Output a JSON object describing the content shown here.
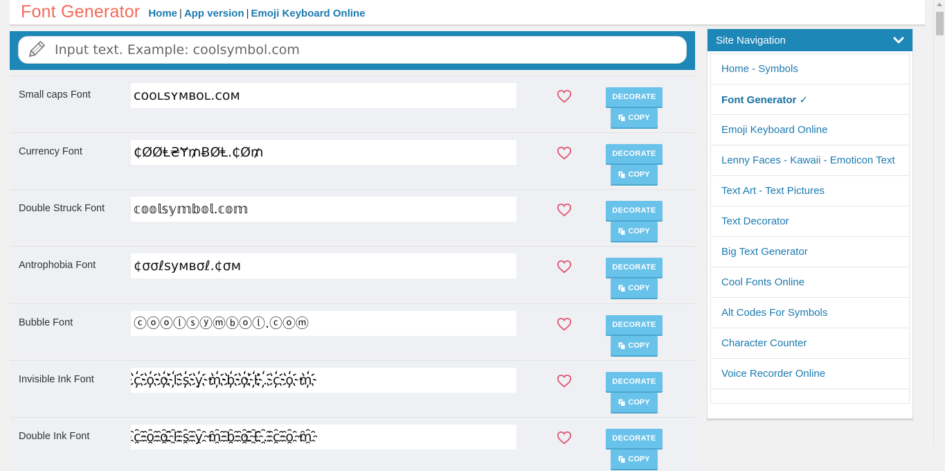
{
  "header": {
    "brand": "Font Generator",
    "nav": [
      "Home",
      "App version",
      "Emoji Keyboard Online"
    ],
    "separator": "|"
  },
  "input": {
    "placeholder": "Input text. Example: coolsymbol.com",
    "icon": "pencil-icon"
  },
  "buttons": {
    "decorate": "DECORATE",
    "copy": "COPY"
  },
  "fonts": [
    {
      "label": "Small caps Font",
      "output": "ᴄᴏᴏʟsʏᴍʙᴏʟ.ᴄᴏᴍ"
    },
    {
      "label": "Currency Font",
      "output": "₵ØØⱠ₴Ɏ₥ɃØⱠ.₵Ø₥"
    },
    {
      "label": "Double Struck Font",
      "output": "𝕔𝕠𝕠𝕝𝕤𝕪𝕞𝕓𝕠𝕝.𝕔𝕠𝕞"
    },
    {
      "label": "Antrophobia Font",
      "output": "¢σσℓѕумвσℓ.¢σм"
    },
    {
      "label": "Bubble Font",
      "output": "ⓒⓞⓞⓛⓢⓨⓜⓑⓞⓛ.ⓒⓞⓜ"
    },
    {
      "label": "Invisible Ink Font",
      "output": "c҉o҉o҉l҉s҉y҉m҉b҉o҉l҉.҉c҉o҉m҉"
    },
    {
      "label": "Double Ink Font",
      "output": "c҈o҈o҈l҈s҈y҈m҈b҈o҈l҈.҈c҈o҈m҈"
    }
  ],
  "sidebar": {
    "title": "Site Navigation",
    "items": [
      {
        "label": "Home - Symbols"
      },
      {
        "label": "Font Generator ✓",
        "active": true
      },
      {
        "label": "Emoji Keyboard Online"
      },
      {
        "label": "Lenny Faces - Kawaii - Emoticon Text"
      },
      {
        "label": "Text Art - Text Pictures"
      },
      {
        "label": "Text Decorator"
      },
      {
        "label": "Big Text Generator"
      },
      {
        "label": "Cool Fonts Online"
      },
      {
        "label": "Alt Codes For Symbols"
      },
      {
        "label": "Character Counter"
      },
      {
        "label": "Voice Recorder Online"
      }
    ]
  },
  "colors": {
    "brand": "#f36a5a",
    "accent": "#1d87b8",
    "link": "#1b7ab0",
    "button": "#69c2ea",
    "heart": "#e0526f"
  }
}
